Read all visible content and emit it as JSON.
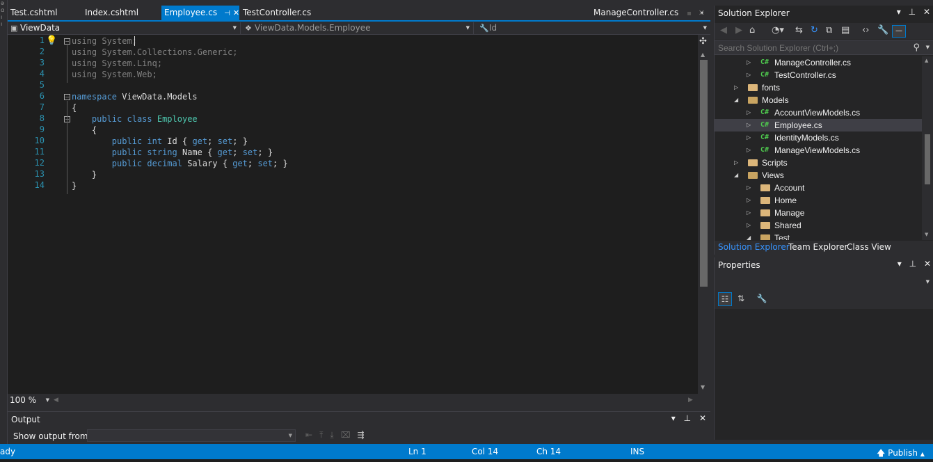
{
  "left_strip": {
    "glyphs": [
      "ə",
      "ɑ",
      "ı",
      "ı"
    ]
  },
  "tabs": [
    {
      "label": "Test.cshtml"
    },
    {
      "label": "Index.cshtml"
    },
    {
      "label": "Employee.cs",
      "active": true
    },
    {
      "label": "TestController.cs"
    },
    {
      "label": "ManageController.cs"
    }
  ],
  "navbar": {
    "project": "ViewData",
    "type": "ViewData.Models.Employee",
    "member": "Id"
  },
  "editor": {
    "line_numbers": [
      "1",
      "2",
      "3",
      "4",
      "5",
      "6",
      "7",
      "8",
      "9",
      "10",
      "11",
      "12",
      "13",
      "14"
    ],
    "lines": [
      [
        {
          "t": "using",
          "c": "kw dim"
        },
        {
          "t": " System;",
          "c": "dim"
        }
      ],
      [
        {
          "t": "using",
          "c": "kw dim"
        },
        {
          "t": " System.Collections.Generic;",
          "c": "dim"
        }
      ],
      [
        {
          "t": "using",
          "c": "kw dim"
        },
        {
          "t": " System.Linq;",
          "c": "dim"
        }
      ],
      [
        {
          "t": "using",
          "c": "kw dim"
        },
        {
          "t": " System.Web;",
          "c": "dim"
        }
      ],
      [],
      [
        {
          "t": "namespace",
          "c": "kw"
        },
        {
          "t": " ViewData.Models",
          "c": ""
        }
      ],
      [
        {
          "t": "{",
          "c": ""
        }
      ],
      [
        {
          "t": "    ",
          "c": ""
        },
        {
          "t": "public",
          "c": "kw"
        },
        {
          "t": " ",
          "c": ""
        },
        {
          "t": "class",
          "c": "kw"
        },
        {
          "t": " ",
          "c": ""
        },
        {
          "t": "Employee",
          "c": "ty"
        }
      ],
      [
        {
          "t": "    {",
          "c": ""
        }
      ],
      [
        {
          "t": "        ",
          "c": ""
        },
        {
          "t": "public",
          "c": "kw"
        },
        {
          "t": " ",
          "c": ""
        },
        {
          "t": "int",
          "c": "kw"
        },
        {
          "t": " Id { ",
          "c": ""
        },
        {
          "t": "get",
          "c": "kw"
        },
        {
          "t": "; ",
          "c": ""
        },
        {
          "t": "set",
          "c": "kw"
        },
        {
          "t": "; }",
          "c": ""
        }
      ],
      [
        {
          "t": "        ",
          "c": ""
        },
        {
          "t": "public",
          "c": "kw"
        },
        {
          "t": " ",
          "c": ""
        },
        {
          "t": "string",
          "c": "kw"
        },
        {
          "t": " Name { ",
          "c": ""
        },
        {
          "t": "get",
          "c": "kw"
        },
        {
          "t": "; ",
          "c": ""
        },
        {
          "t": "set",
          "c": "kw"
        },
        {
          "t": "; }",
          "c": ""
        }
      ],
      [
        {
          "t": "        ",
          "c": ""
        },
        {
          "t": "public",
          "c": "kw"
        },
        {
          "t": " ",
          "c": ""
        },
        {
          "t": "decimal",
          "c": "kw"
        },
        {
          "t": " Salary { ",
          "c": ""
        },
        {
          "t": "get",
          "c": "kw"
        },
        {
          "t": "; ",
          "c": ""
        },
        {
          "t": "set",
          "c": "kw"
        },
        {
          "t": "; }",
          "c": ""
        }
      ],
      [
        {
          "t": "    }",
          "c": ""
        }
      ],
      [
        {
          "t": "}",
          "c": ""
        }
      ]
    ],
    "zoom": "100 %"
  },
  "output": {
    "title": "Output",
    "show_from_label": "Show output from:",
    "show_from_value": ""
  },
  "solution_explorer": {
    "title": "Solution Explorer",
    "search_placeholder": "Search Solution Explorer (Ctrl+;)",
    "tree": [
      {
        "label": "ManageController.cs",
        "kind": "cs",
        "level": 2,
        "expander": "collapsed"
      },
      {
        "label": "TestController.cs",
        "kind": "cs",
        "level": 2,
        "expander": "collapsed"
      },
      {
        "label": "fonts",
        "kind": "folder",
        "level": 1,
        "expander": "collapsed"
      },
      {
        "label": "Models",
        "kind": "folder-open",
        "level": 1,
        "expander": "expanded"
      },
      {
        "label": "AccountViewModels.cs",
        "kind": "cs",
        "level": 2,
        "expander": "collapsed"
      },
      {
        "label": "Employee.cs",
        "kind": "cs",
        "level": 2,
        "expander": "collapsed",
        "selected": true
      },
      {
        "label": "IdentityModels.cs",
        "kind": "cs",
        "level": 2,
        "expander": "collapsed"
      },
      {
        "label": "ManageViewModels.cs",
        "kind": "cs",
        "level": 2,
        "expander": "collapsed"
      },
      {
        "label": "Scripts",
        "kind": "folder",
        "level": 1,
        "expander": "collapsed"
      },
      {
        "label": "Views",
        "kind": "folder-open",
        "level": 1,
        "expander": "expanded"
      },
      {
        "label": "Account",
        "kind": "folder",
        "level": 2,
        "expander": "collapsed"
      },
      {
        "label": "Home",
        "kind": "folder",
        "level": 2,
        "expander": "collapsed"
      },
      {
        "label": "Manage",
        "kind": "folder",
        "level": 2,
        "expander": "collapsed"
      },
      {
        "label": "Shared",
        "kind": "folder",
        "level": 2,
        "expander": "collapsed"
      },
      {
        "label": "Test",
        "kind": "folder-open",
        "level": 2,
        "expander": "expanded"
      }
    ],
    "bottom_tabs": [
      "Solution Explorer",
      "Team Explorer",
      "Class View"
    ]
  },
  "properties": {
    "title": "Properties"
  },
  "status_bar": {
    "ready": "ady",
    "ln": "Ln 1",
    "col": "Col 14",
    "ch": "Ch 14",
    "mode": "INS",
    "publish": "Publish"
  },
  "colors": {
    "accent": "#007acc",
    "keyword": "#569cd6",
    "type": "#4ec9b0",
    "line_number": "#2b91af",
    "folder": "#dcb67a",
    "cs_icon": "#4ec94e"
  }
}
